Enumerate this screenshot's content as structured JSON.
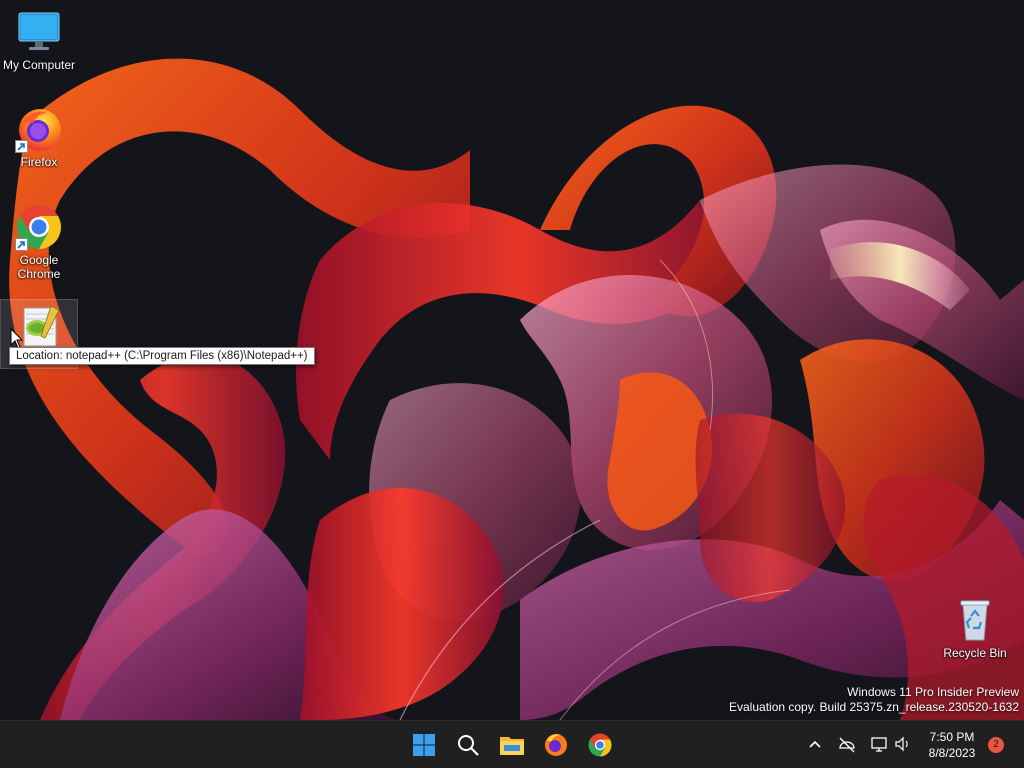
{
  "desktop": {
    "icons": [
      {
        "label": "My Computer",
        "icon": "monitor-icon"
      },
      {
        "label": "Firefox",
        "icon": "firefox-icon"
      },
      {
        "label": "Google Chrome",
        "icon": "chrome-icon"
      },
      {
        "label": "",
        "icon": "notepadpp-icon"
      },
      {
        "label": "Recycle Bin",
        "icon": "recycle-bin-icon"
      }
    ],
    "tooltip": "Location: notepad++ (C:\\Program Files (x86)\\Notepad++)",
    "watermark": {
      "line1": "Windows 11 Pro Insider Preview",
      "line2": "Evaluation copy. Build 25375.zn_release.230520-1632"
    }
  },
  "taskbar": {
    "pinned": [
      "windows-start-icon",
      "search-icon",
      "file-explorer-icon",
      "firefox-icon",
      "chrome-icon"
    ],
    "tray": [
      "chevron-up-icon",
      "network-off-icon",
      "display-icon",
      "speaker-icon"
    ],
    "clock": {
      "time": "7:50 PM",
      "date": "8/8/2023"
    },
    "notification_count": "2"
  },
  "colors": {
    "taskbar": "#202020",
    "start_blue": "#3aa0f0",
    "folder_yellow": "#f4b836",
    "badge": "#e8563f"
  }
}
